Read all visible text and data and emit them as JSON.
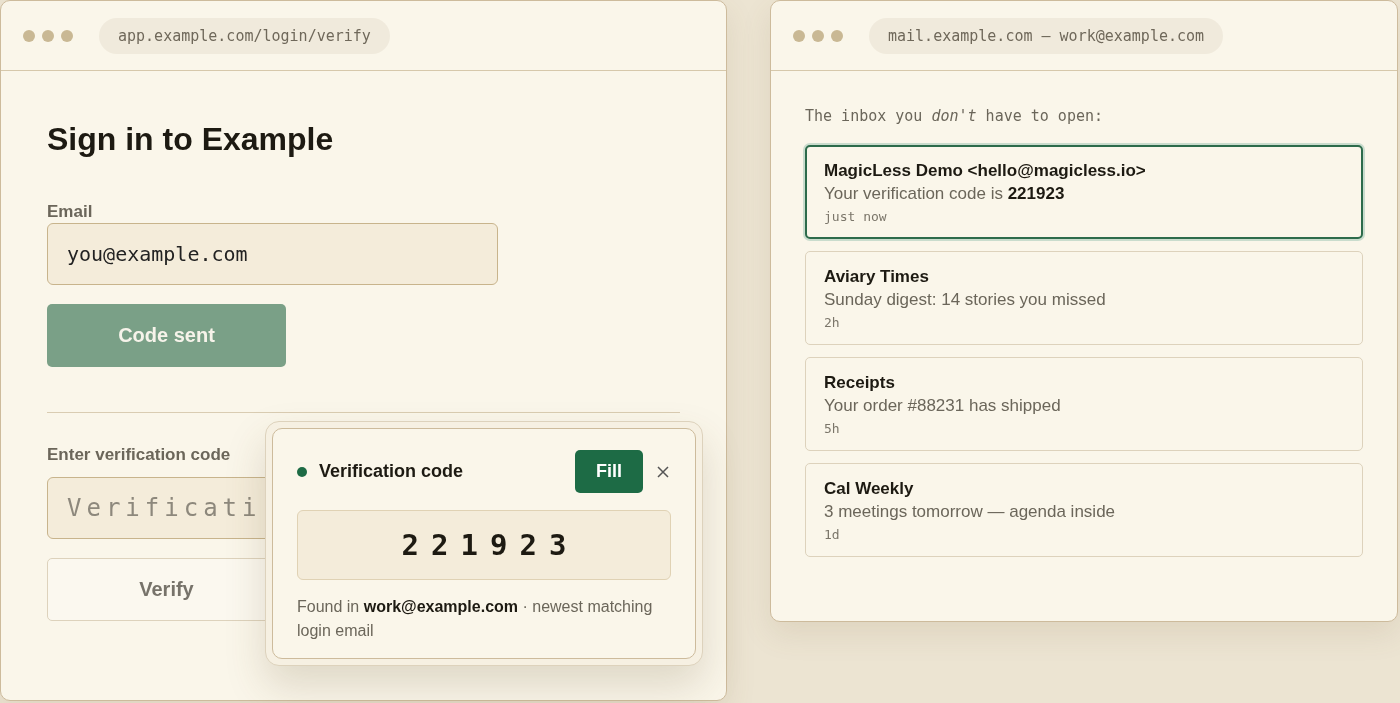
{
  "login_window": {
    "address": "app.example.com/login/verify",
    "title": "Sign in to Example",
    "email_label": "Email",
    "email_value": "you@example.com",
    "send_button": {
      "label": "Code sent",
      "disabled": true
    },
    "code_label": "Enter verification code",
    "code_placeholder": "Verificati",
    "verify_button": "Verify"
  },
  "code_popup": {
    "title": "Verification code",
    "fill_button": "Fill",
    "code": "221923",
    "note": "Found in **work@example.com** · newest matching login email"
  },
  "mail_window": {
    "address": "mail.example.com — work@example.com",
    "intro": "The inbox you *don't* have to open:",
    "messages": [
      {
        "sender": "MagicLess Demo <hello@magicless.io>",
        "preview": "Your verification code is **221923**",
        "time": "just now",
        "selected": true
      },
      {
        "sender": "Aviary Times",
        "preview": "Sunday digest: 14 stories you missed",
        "time": "2h",
        "selected": false
      },
      {
        "sender": "Receipts",
        "preview": "Your order #88231 has shipped",
        "time": "5h",
        "selected": false
      },
      {
        "sender": "Cal Weekly",
        "preview": "3 meetings tomorrow — agenda inside",
        "time": "1d",
        "selected": false
      }
    ]
  }
}
